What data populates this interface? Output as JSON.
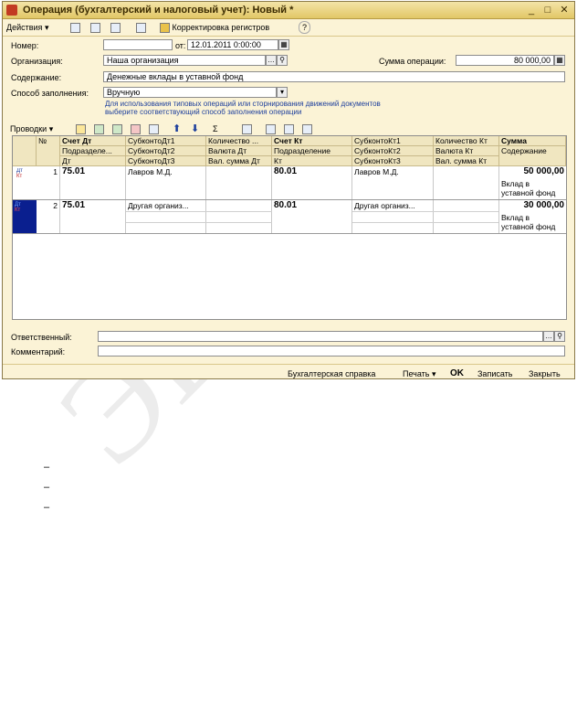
{
  "window": {
    "title": "Операция (бухгалтерский и налоговый учет): Новый *"
  },
  "toolbar": {
    "actions": "Действия",
    "registers": "Корректировка регистров",
    "help": "?"
  },
  "form": {
    "number_label": "Номер:",
    "number_value": "",
    "from_label": "от:",
    "date_value": "12.01.2011  0:00:00",
    "org_label": "Организация:",
    "org_value": "Наша организация",
    "sum_label": "Сумма операции:",
    "sum_value": "80 000,00",
    "content_label": "Содержание:",
    "content_value": "Денежные вклады в уставной фонд",
    "fill_label": "Способ заполнения:",
    "fill_value": "Вручную",
    "hint_line1": "Для использования типовых операций или сторнирования движений документов",
    "hint_line2": "выберите соответствующий способ заполнения операции"
  },
  "entries_toolbar": {
    "label": "Проводки"
  },
  "grid": {
    "headers": {
      "num": "№",
      "dt_acc": "Счет Дт",
      "dt_sub1": "СубконтоДт1",
      "dt_qty": "Количество ...",
      "kt_acc": "Счет Кт",
      "kt_sub1": "СубконтоКт1",
      "kt_qty": "Количество Кт",
      "sum": "Сумма",
      "dt_dept": "Подразделе...",
      "dt_sub2": "СубконтоДт2",
      "dt_cur": "Валюта Дт",
      "kt_dept": "Подразделение",
      "kt_sub2": "СубконтоКт2",
      "kt_cur": "Валюта Кт",
      "content": "Содержание",
      "dt_tag": "Дт",
      "dt_sub3": "СубконтоДт3",
      "dt_cur_sum": "Вал. сумма Дт",
      "kt_tag": "Кт",
      "kt_sub3": "СубконтоКт3",
      "kt_cur_sum": "Вал. сумма Кт"
    },
    "rows": [
      {
        "num": "1",
        "dt_acc": "75.01",
        "dt_sub1": "Лавров М.Д.",
        "kt_acc": "80.01",
        "kt_sub1": "Лавров М.Д.",
        "sum": "50 000,00",
        "content1": "Вклад в",
        "content2": "уставной фонд"
      },
      {
        "num": "2",
        "dt_acc": "75.01",
        "dt_sub1": "Другая организ...",
        "kt_acc": "80.01",
        "kt_sub1": "Другая организ...",
        "sum": "30 000,00",
        "content1": "Вклад в",
        "content2": "уставной фонд"
      }
    ],
    "row_icon": {
      "dt": "Дт",
      "kt": "Кт"
    }
  },
  "footer": {
    "responsible_label": "Ответственный:",
    "comment_label": "Комментарий:"
  },
  "statusbar": {
    "report": "Бухгалтерская справка",
    "print": "Печать",
    "ok": "OK",
    "save": "Записать",
    "close": "Закрыть"
  },
  "below": {
    "dashes": [
      "–",
      "–",
      "–"
    ],
    "watermark": "ЭБС ПГУ"
  },
  "colors": {
    "window_bg": "#fbf3d6",
    "title_bg": "#e2c766",
    "hint": "#1c3e9c",
    "selected_row": "#0a1f8f"
  }
}
